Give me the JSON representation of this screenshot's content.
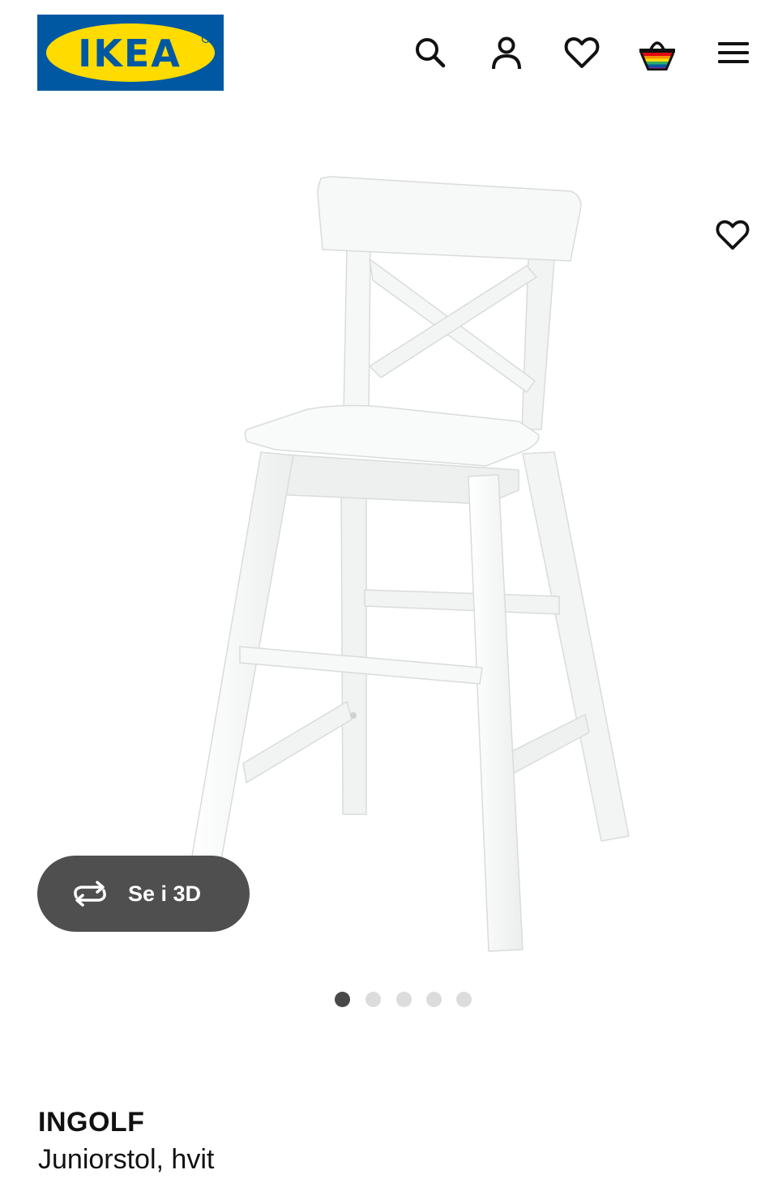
{
  "header": {
    "logo_text": "IKEA",
    "logo_colors": {
      "blue": "#0058A3",
      "yellow": "#FFDB00"
    },
    "nav_icons": [
      {
        "name": "search-icon"
      },
      {
        "name": "user-icon"
      },
      {
        "name": "heart-icon"
      },
      {
        "name": "basket-icon"
      },
      {
        "name": "menu-icon"
      }
    ]
  },
  "product": {
    "gallery": {
      "view_3d_label": "Se i 3D",
      "dots_count": 5,
      "active_dot": 0
    },
    "favorite_icon": "heart-outline-icon",
    "name": "INGOLF",
    "description": "Juniorstol, hvit"
  }
}
